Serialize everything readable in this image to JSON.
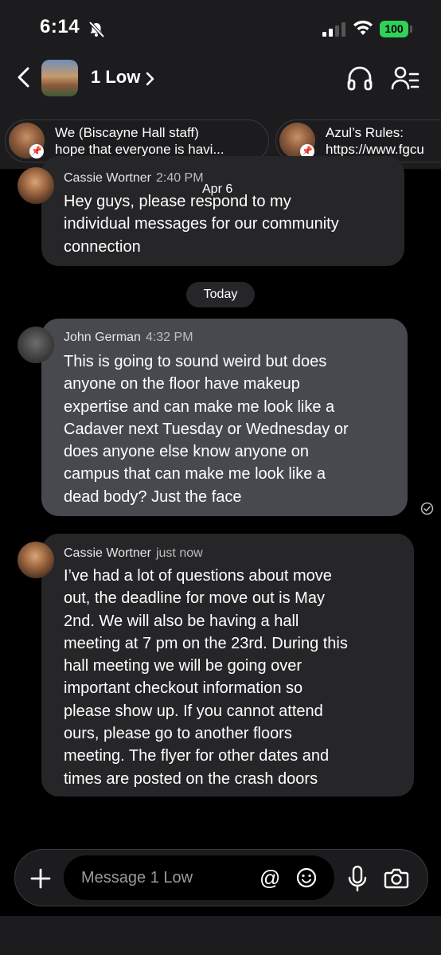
{
  "status_bar": {
    "time": "6:14",
    "battery": "100"
  },
  "header": {
    "group_name": "1 Low"
  },
  "pinned": [
    {
      "line1": "We (Biscayne Hall staff)",
      "line2": "hope that everyone is havi..."
    },
    {
      "line1": "Azul’s Rules:",
      "line2": "https://www.fgcu"
    }
  ],
  "date_separator": "Apr 6",
  "today_label": "Today",
  "messages": [
    {
      "sender": "Cassie Wortner",
      "time": "2:40 PM",
      "lines": [
        "Hey guys, please respond to my",
        "individual messages for our community",
        "connection"
      ]
    },
    {
      "sender": "John German",
      "time": "4:32 PM",
      "lines": [
        "This is going to sound weird but does",
        "anyone on the floor have makeup",
        "expertise and can make me look like a",
        "Cadaver next Tuesday or Wednesday or",
        "does anyone else know anyone on",
        "campus that can make me look like a",
        "dead body? Just the face"
      ]
    },
    {
      "sender": "Cassie Wortner",
      "time": "just now",
      "lines": [
        "I’ve had a lot of questions about move",
        "out, the deadline for move out is May",
        "2nd. We will also be having a hall",
        "meeting at 7 pm on the 23rd. During this",
        "hall meeting we will be going over",
        "important checkout information so",
        "please show up. If you cannot attend",
        "ours, please go to another floors",
        "meeting. The flyer for other dates and",
        "times are posted on the crash doors"
      ]
    }
  ],
  "composer": {
    "placeholder": "Message 1 Low",
    "at_symbol": "@"
  },
  "colors": {
    "battery": "#2fd158",
    "bubble_dark": "#262628",
    "bubble_light": "#47494f"
  }
}
